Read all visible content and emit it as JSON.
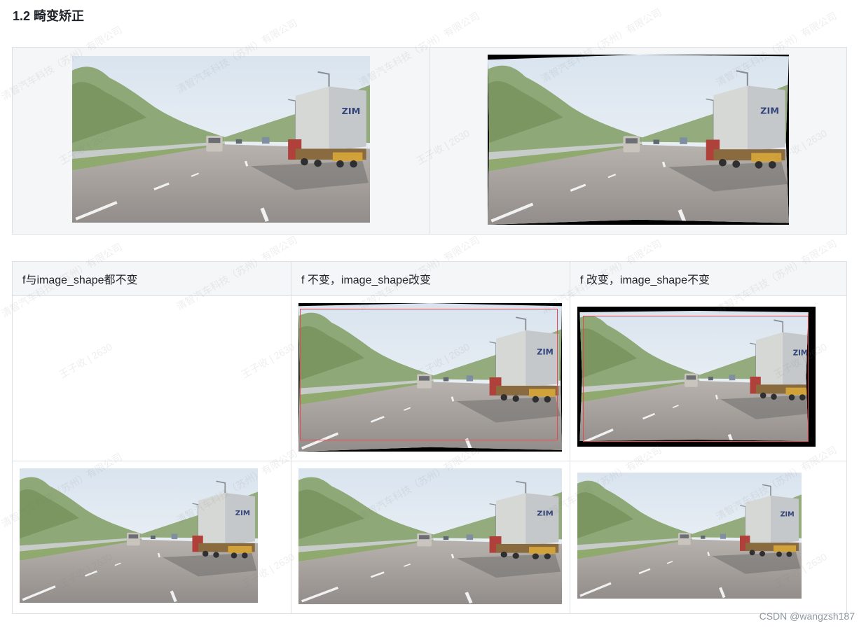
{
  "heading": "1.2 畸变矫正",
  "table2": {
    "headers": [
      "f与image_shape都不变",
      "f 不变，image_shape改变",
      "f 改变，image_shape不变"
    ]
  },
  "image_alt": "highway-road-with-container-truck-photo",
  "watermark": {
    "company": "清智汽车科技（苏州）有限公司",
    "person": "王子收 | 2630"
  },
  "footer": {
    "credit": "CSDN @wangzsh187"
  },
  "colors": {
    "table_border": "#dee0e3",
    "header_bg": "#f5f6f7",
    "crop_box": "#e5484d",
    "credit_text": "#8f959e"
  }
}
